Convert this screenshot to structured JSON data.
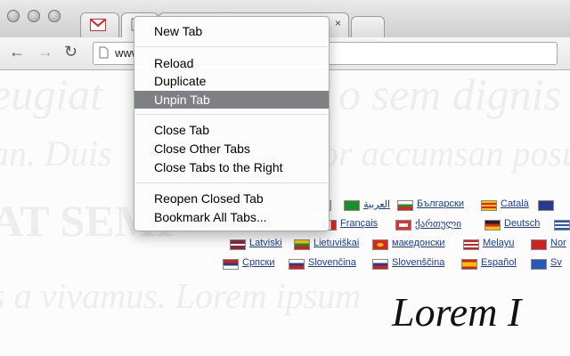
{
  "window": {
    "tab_close_glyph": "×"
  },
  "toolbar": {
    "url": "www"
  },
  "menu": {
    "new_tab": "New Tab",
    "reload": "Reload",
    "duplicate": "Duplicate",
    "unpin_tab": "Unpin Tab",
    "close_tab": "Close Tab",
    "close_other_tabs": "Close Other Tabs",
    "close_tabs_right": "Close Tabs to the Right",
    "reopen_closed_tab": "Reopen Closed Tab",
    "bookmark_all_tabs": "Bookmark All Tabs...",
    "highlight_color": "#7e8083"
  },
  "page": {
    "ghost_lines": [
      "eugiat",
      "o sem dignis",
      "an. Duis",
      "or accumsan posu",
      "AT SEMP",
      "s a vivamus. Lorem ipsum"
    ],
    "languages_row1": [
      "العربية",
      "Български",
      "Català"
    ],
    "languages_row2": [
      "Français",
      "ქართული",
      "Deutsch"
    ],
    "languages_row3": [
      "Latviski",
      "Lietuviškai",
      "македонски",
      "Melayu",
      "Nor"
    ],
    "languages_row4": [
      "Српски",
      "Slovenčina",
      "Slovenščina",
      "Español",
      "Sv"
    ],
    "hero_text": "Lorem I"
  }
}
